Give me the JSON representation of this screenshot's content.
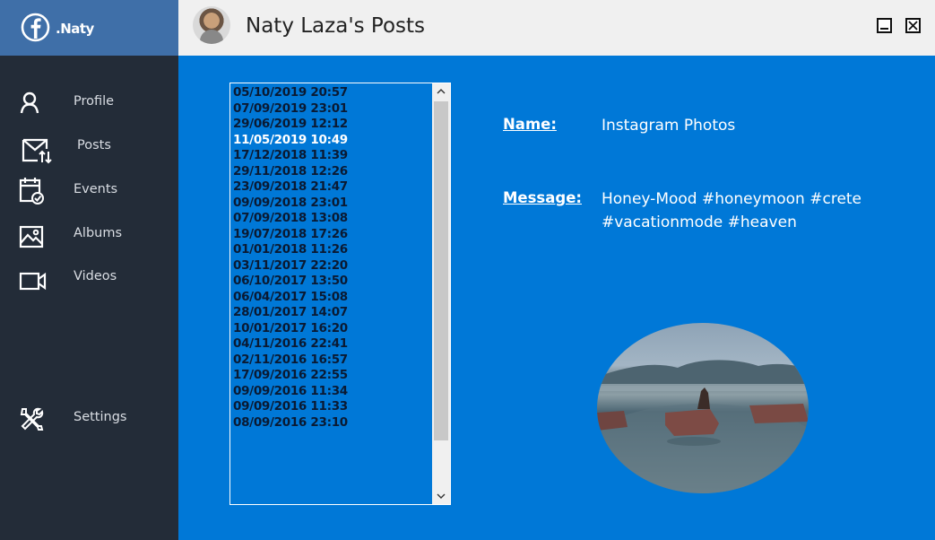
{
  "brand": {
    "name": ".Naty",
    "logo_icon": "facebook-icon"
  },
  "sidebar": {
    "items": [
      {
        "label": "Profile",
        "icon": "user-icon"
      },
      {
        "label": "Posts",
        "icon": "posts-mail-icon"
      },
      {
        "label": "Events",
        "icon": "calendar-icon"
      },
      {
        "label": "Albums",
        "icon": "image-icon"
      },
      {
        "label": "Videos",
        "icon": "video-icon"
      }
    ],
    "settings": {
      "label": "Settings",
      "icon": "settings-tools-icon"
    }
  },
  "titlebar": {
    "title": "Naty Laza's Posts"
  },
  "posts": {
    "items": [
      "05/10/2019 20:57",
      "07/09/2019 23:01",
      "29/06/2019 12:12",
      "11/05/2019 10:49",
      "17/12/2018 11:39",
      "29/11/2018 12:26",
      "23/09/2018 21:47",
      "09/09/2018 23:01",
      "07/09/2018 13:08",
      "19/07/2018 17:26",
      "01/01/2018 11:26",
      "03/11/2017 22:20",
      "06/10/2017 13:50",
      "06/04/2017 15:08",
      "28/01/2017 14:07",
      "10/01/2017 16:20",
      "04/11/2016 22:41",
      "02/11/2016 16:57",
      "17/09/2016 22:55",
      "09/09/2016 11:34",
      "09/09/2016 11:33",
      "08/09/2016 23:10"
    ],
    "selected": "11/05/2019 10:49"
  },
  "details": {
    "name_label": "Name:",
    "name_value": "Instagram Photos",
    "message_label": "Message:",
    "message_line1": "Honey-Mood #honeymoon #crete",
    "message_line2": "#vacationmode #heaven"
  },
  "colors": {
    "accent": "#0078d7",
    "sidebar": "#232c38",
    "brand_bar": "#3f6fa8"
  }
}
